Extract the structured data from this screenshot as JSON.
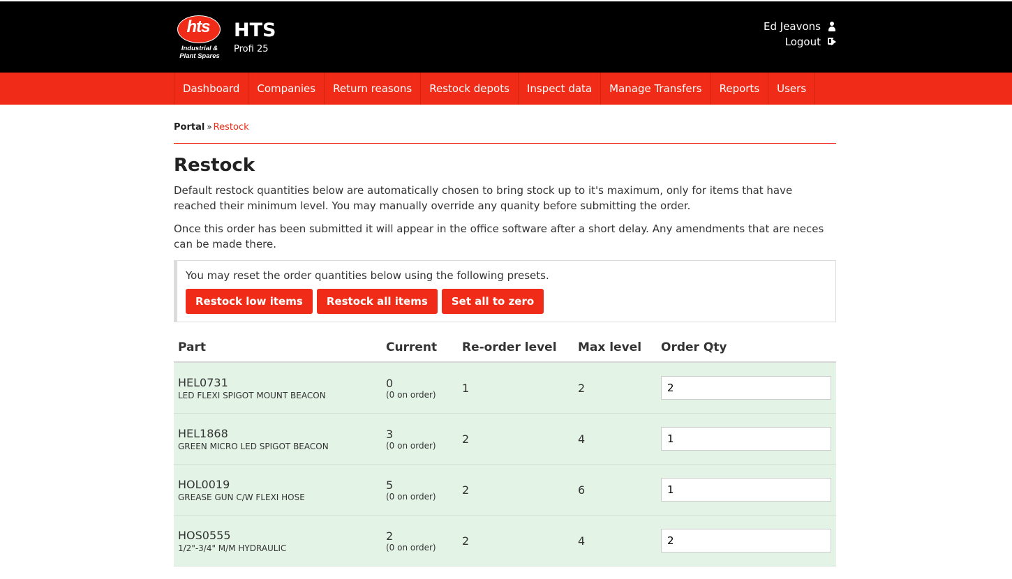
{
  "header": {
    "logo": {
      "mark": "hts",
      "subtitle_line1": "Industrial &",
      "subtitle_line2": "Plant Spares"
    },
    "title": "HTS",
    "subtitle": "Profi 25",
    "user_name": "Ed Jeavons",
    "user_icon": "user-icon",
    "logout_label": "Logout",
    "logout_icon": "sign-out-icon"
  },
  "nav": {
    "items": [
      {
        "label": "Dashboard"
      },
      {
        "label": "Companies"
      },
      {
        "label": "Return reasons"
      },
      {
        "label": "Restock depots"
      },
      {
        "label": "Inspect data"
      },
      {
        "label": "Manage Transfers"
      },
      {
        "label": "Reports"
      },
      {
        "label": "Users"
      }
    ]
  },
  "breadcrumb": {
    "root": "Portal",
    "separator": "»",
    "current": "Restock"
  },
  "page": {
    "title": "Restock",
    "intro_1": "Default restock quantities below are automatically chosen to bring stock up to it's maximum, only for items that have reached their minimum level. You may manually override any quanity before submitting the order.",
    "intro_2": "Once this order has been submitted it will appear in the office software after a short delay. Any amendments that are neces can be made there."
  },
  "presets": {
    "text": "You may reset the order quantities below using the following presets.",
    "btn_low": "Restock low items",
    "btn_all": "Restock all items",
    "btn_zero": "Set all to zero"
  },
  "table": {
    "headers": {
      "part": "Part",
      "current": "Current",
      "reorder": "Re-order level",
      "max": "Max level",
      "qty": "Order Qty"
    },
    "rows": [
      {
        "code": "HEL0731",
        "desc": "LED FLEXI SPIGOT MOUNT BEACON",
        "current": "0",
        "on_order": "(0 on order)",
        "reorder": "1",
        "max": "2",
        "qty": "2"
      },
      {
        "code": "HEL1868",
        "desc": "GREEN MICRO LED SPIGOT BEACON",
        "current": "3",
        "on_order": "(0 on order)",
        "reorder": "2",
        "max": "4",
        "qty": "1"
      },
      {
        "code": "HOL0019",
        "desc": "GREASE GUN C/W FLEXI HOSE",
        "current": "5",
        "on_order": "(0 on order)",
        "reorder": "2",
        "max": "6",
        "qty": "1"
      },
      {
        "code": "HOS0555",
        "desc": "1/2\"-3/4\" M/M HYDRAULIC",
        "current": "2",
        "on_order": "(0 on order)",
        "reorder": "2",
        "max": "4",
        "qty": "2"
      }
    ]
  },
  "colors": {
    "brand_red": "#f02c18",
    "header_black": "#000000",
    "row_green": "#e3f3e6"
  }
}
